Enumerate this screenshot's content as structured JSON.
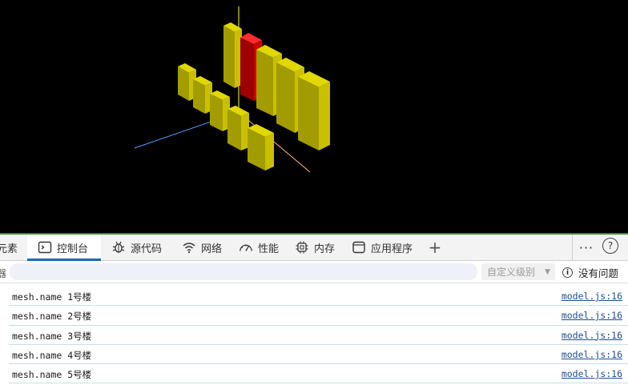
{
  "viewport": {
    "background": "#000000",
    "building_color": "#c8c000",
    "selected_color": "#d40000",
    "axis_colors": {
      "x": "#4da0ff",
      "y": "#ffff40",
      "z": "#ffb070"
    }
  },
  "devtools": {
    "tabs": [
      {
        "id": "elements",
        "label": "元素",
        "icon": "none",
        "active": false
      },
      {
        "id": "console",
        "label": "控制台",
        "icon": "console-icon",
        "active": true
      },
      {
        "id": "sources",
        "label": "源代码",
        "icon": "bug-icon",
        "active": false
      },
      {
        "id": "network",
        "label": "网络",
        "icon": "wifi-icon",
        "active": false
      },
      {
        "id": "performance",
        "label": "性能",
        "icon": "gauge-icon",
        "active": false
      },
      {
        "id": "memory",
        "label": "内存",
        "icon": "chip-icon",
        "active": false
      },
      {
        "id": "application",
        "label": "应用程序",
        "icon": "window-icon",
        "active": false
      }
    ],
    "add_tab_glyph": "+",
    "more_glyph": "···",
    "help_glyph": "?",
    "filter": {
      "left_glyph": "器",
      "placeholder": "",
      "level_label": "自定义级别",
      "issues_label": "没有问题",
      "info_glyph": "i"
    },
    "console": [
      {
        "message": "mesh.name 1号楼",
        "source": "model.js:16"
      },
      {
        "message": "mesh.name 2号楼",
        "source": "model.js:16"
      },
      {
        "message": "mesh.name 3号楼",
        "source": "model.js:16"
      },
      {
        "message": "mesh.name 4号楼",
        "source": "model.js:16"
      },
      {
        "message": "mesh.name 5号楼",
        "source": "model.js:16"
      }
    ]
  }
}
